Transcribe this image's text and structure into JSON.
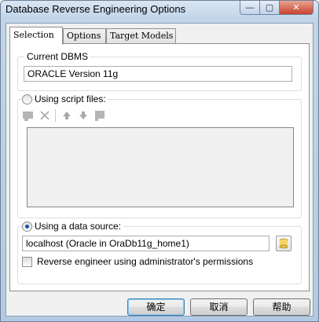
{
  "window": {
    "title": "Database Reverse Engineering Options",
    "minimize_glyph": "—",
    "maximize_glyph": "▢",
    "close_glyph": "✕"
  },
  "tabs": [
    {
      "label": "Selection",
      "active": true
    },
    {
      "label": "Options",
      "active": false
    },
    {
      "label": "Target Models",
      "active": false
    }
  ],
  "selection": {
    "current_dbms": {
      "legend": "Current DBMS",
      "value": "ORACLE Version 11g"
    },
    "script_files": {
      "label": "Using script files:",
      "selected": false,
      "toolbar_icons": [
        "add-file-icon",
        "delete-icon",
        "move-up-icon",
        "move-down-icon",
        "browse-icon"
      ]
    },
    "data_source": {
      "label": "Using a data source:",
      "selected": true,
      "value": "localhost (Oracle in OraDb11g_home1)",
      "admin_checkbox_label": "Reverse engineer using administrator's permissions",
      "admin_checked": false
    }
  },
  "buttons": {
    "ok": "确定",
    "cancel": "取消",
    "help": "帮助"
  }
}
